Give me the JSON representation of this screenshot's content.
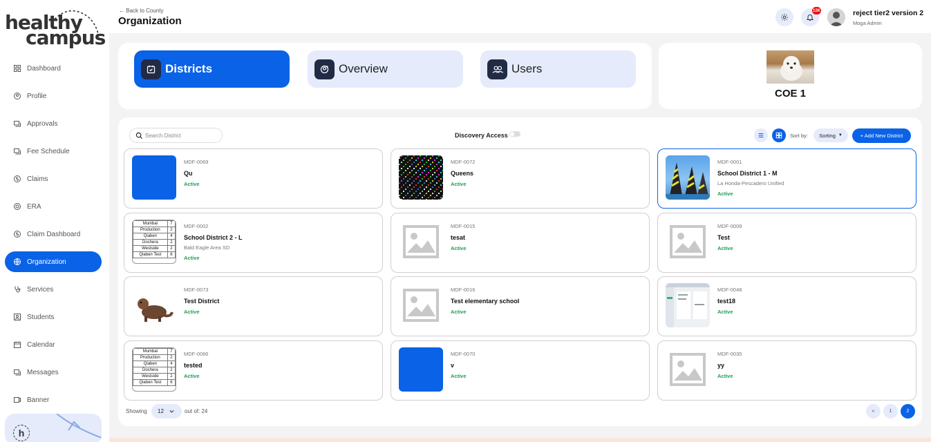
{
  "brand": {
    "line1": "healthy",
    "line2": "campus",
    "mini": "h"
  },
  "sidebar": {
    "items": [
      {
        "label": "Dashboard",
        "icon": "dashboard-icon"
      },
      {
        "label": "Profile",
        "icon": "profile-icon"
      },
      {
        "label": "Approvals",
        "icon": "approvals-icon"
      },
      {
        "label": "Fee Schedule",
        "icon": "fee-schedule-icon"
      },
      {
        "label": "Claims",
        "icon": "claims-icon"
      },
      {
        "label": "ERA",
        "icon": "era-icon"
      },
      {
        "label": "Claim Dashboard",
        "icon": "claim-dashboard-icon"
      },
      {
        "label": "Organization",
        "icon": "globe-icon",
        "active": true
      },
      {
        "label": "Services",
        "icon": "stethoscope-icon"
      },
      {
        "label": "Students",
        "icon": "students-icon"
      },
      {
        "label": "Calendar",
        "icon": "calendar-icon"
      },
      {
        "label": "Messages",
        "icon": "messages-icon"
      },
      {
        "label": "Banner",
        "icon": "banner-icon"
      }
    ]
  },
  "header": {
    "back_label": "Back to County",
    "title": "Organization",
    "notification_count": "12K",
    "user_name": "reject tier2 version 2",
    "user_role": "Moga Admin"
  },
  "tabs": [
    {
      "label": "Districts",
      "active": true,
      "icon": "calendar-check-icon"
    },
    {
      "label": "Overview",
      "active": false,
      "icon": "overview-icon"
    },
    {
      "label": "Users",
      "active": false,
      "icon": "users-icon"
    }
  ],
  "coe": {
    "name": "COE 1"
  },
  "toolbar": {
    "search_placeholder": "Search District",
    "discovery_label": "Discovery Access",
    "sort_by_label": "Sort by:",
    "sorting_label": "Sorting",
    "add_label": "+ Add New District"
  },
  "cards": [
    {
      "code": "MDF-0069",
      "name": "Qu",
      "sub": "",
      "status": "Active",
      "thumb": "blue"
    },
    {
      "code": "MDF-0072",
      "name": "Queens",
      "sub": "",
      "status": "Active",
      "thumb": "noise"
    },
    {
      "code": "MDF-0001",
      "name": "School District 1 - M",
      "sub": "La Honda-Pescadero Unified",
      "status": "Active",
      "thumb": "art",
      "selected": true
    },
    {
      "code": "MDF-0002",
      "name": "School District 2 - L",
      "sub": "Bald Eagle Area SD",
      "status": "Active",
      "thumb": "table"
    },
    {
      "code": "MDF-0015",
      "name": "tesat",
      "sub": "",
      "status": "Active",
      "thumb": "placeholder"
    },
    {
      "code": "MDF-0008",
      "name": "Test",
      "sub": "",
      "status": "Active",
      "thumb": "placeholder"
    },
    {
      "code": "MDF-0073",
      "name": "Test District",
      "sub": "",
      "status": "Active",
      "thumb": "otter"
    },
    {
      "code": "MDF-0016",
      "name": "Test elementary school",
      "sub": "",
      "status": "Active",
      "thumb": "placeholder"
    },
    {
      "code": "MDF-0048",
      "name": "test18",
      "sub": "",
      "status": "Active",
      "thumb": "screenshot"
    },
    {
      "code": "MDF-0066",
      "name": "tested",
      "sub": "",
      "status": "Active",
      "thumb": "table"
    },
    {
      "code": "MDF-0070",
      "name": "v",
      "sub": "",
      "status": "Active",
      "thumb": "blue"
    },
    {
      "code": "MDF-0035",
      "name": "yy",
      "sub": "",
      "status": "Active",
      "thumb": "placeholder"
    }
  ],
  "thumb_table": [
    [
      "Mumbai",
      "7"
    ],
    [
      "Production",
      "2"
    ],
    [
      "Qiaben",
      "4"
    ],
    [
      "Dochera",
      "2"
    ],
    [
      "Westside",
      "2"
    ],
    [
      "Qiaben Test",
      "6"
    ]
  ],
  "pagination": {
    "showing_label": "Showing",
    "page_size": "12",
    "out_of_label": "out of: 24",
    "pages": [
      "«",
      "1",
      "2"
    ],
    "current": "2"
  },
  "colors": {
    "primary": "#0a62e6",
    "tint": "#e5ebfb",
    "active_status": "#1f9d55",
    "dark_icon": "#222b45"
  }
}
